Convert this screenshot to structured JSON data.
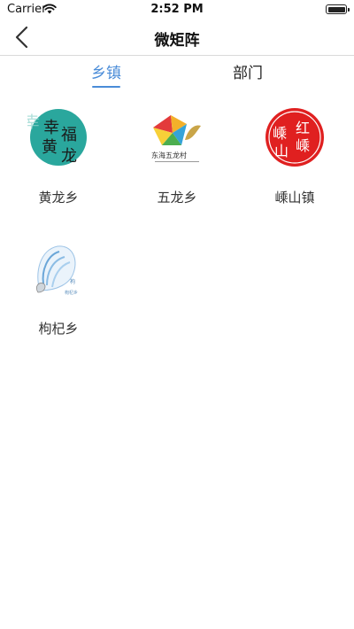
{
  "status_bar": {
    "carrier": "Carrier",
    "time": "2:52 PM"
  },
  "nav": {
    "title": "微矩阵"
  },
  "tabs": [
    {
      "label": "乡镇",
      "active": true
    },
    {
      "label": "部门",
      "active": false
    }
  ],
  "items": [
    {
      "label": "黄龙乡",
      "logo_text": [
        "幸",
        "福",
        "黄",
        "龙"
      ]
    },
    {
      "label": "五龙乡",
      "logo_text": [
        "东海五龙村"
      ]
    },
    {
      "label": "嵊山镇",
      "logo_text": [
        "嵊",
        "山",
        "红",
        "嵊"
      ]
    },
    {
      "label": "枸杞乡",
      "logo_text": [
        "枸杞乡"
      ]
    }
  ],
  "colors": {
    "accent": "#4a8cd8",
    "teal": "#2aa79d",
    "red": "#e02020"
  }
}
